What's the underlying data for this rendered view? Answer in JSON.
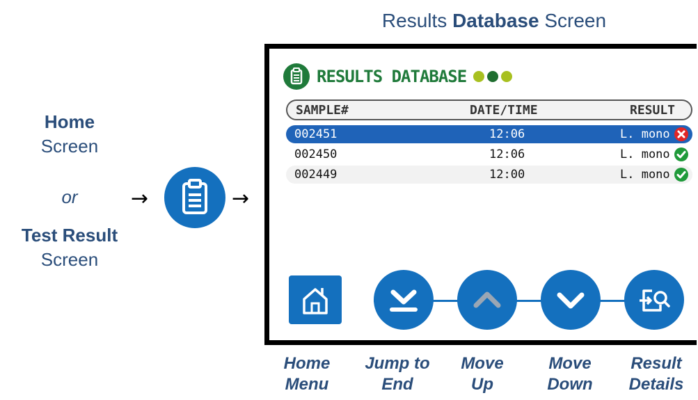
{
  "heading": {
    "pre": "Results ",
    "bold": "Database",
    "post": " Screen"
  },
  "left": {
    "home_bold": "Home",
    "home_screen": "Screen",
    "or": "or",
    "test_bold": "Test Result",
    "test_screen": "Screen"
  },
  "arrow_glyph": "→",
  "screen": {
    "title": "RESULTS DATABASE",
    "dot_colors": [
      "#a8c020",
      "#1f6e30",
      "#a8c020"
    ],
    "columns": {
      "sample": "SAMPLE#",
      "datetime": "DATE/TIME",
      "result": "RESULT"
    },
    "rows": [
      {
        "sample": "002451",
        "time": "12:06",
        "result": "L. mono",
        "status": "fail",
        "selected": true
      },
      {
        "sample": "002450",
        "time": "12:06",
        "result": "L. mono",
        "status": "pass",
        "selected": false
      },
      {
        "sample": "002449",
        "time": "12:00",
        "result": "L. mono",
        "status": "pass",
        "selected": false
      }
    ]
  },
  "captions": {
    "home_menu": [
      "Home",
      "Menu"
    ],
    "jump_end": [
      "Jump to",
      "End"
    ],
    "move_up": [
      "Move",
      "Up"
    ],
    "move_down": [
      "Move",
      "Down"
    ],
    "result_details": [
      "Result",
      "Details"
    ]
  },
  "icons": {
    "clipboard": "clipboard-icon",
    "home": "home-icon",
    "jump_end": "jump-to-end-icon",
    "up": "chevron-up-icon",
    "down": "chevron-down-icon",
    "details": "result-details-icon",
    "pass": "check-icon",
    "fail": "x-icon"
  },
  "colors": {
    "accent_blue": "#1470be",
    "title_green": "#1f7a3a",
    "selected_row": "#1f63b8",
    "pass": "#1f9a3a",
    "fail": "#e22626",
    "up_disabled": "#9aa6b4"
  }
}
